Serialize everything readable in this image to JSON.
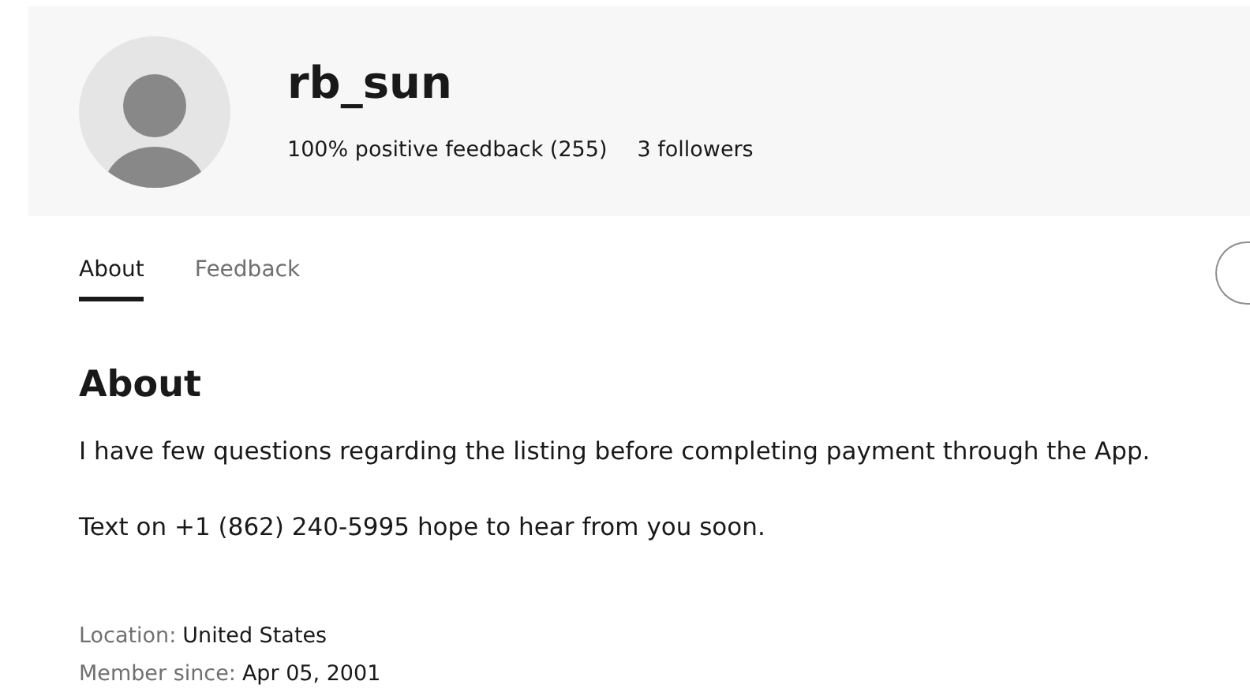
{
  "profile": {
    "username": "rb_sun",
    "feedback": "100% positive feedback (255)",
    "followers": "3 followers"
  },
  "tabs": [
    {
      "label": "About",
      "selected": true
    },
    {
      "label": "Feedback",
      "selected": false
    }
  ],
  "about": {
    "heading": "About",
    "paragraphs": [
      "I have few questions regarding the listing before completing payment through the App.",
      "Text on +1 (862) 240-5995 hope to hear from you soon."
    ],
    "details": [
      {
        "label": "Location:",
        "value": "United States"
      },
      {
        "label": "Member since:",
        "value": "Apr 05, 2001"
      }
    ]
  }
}
